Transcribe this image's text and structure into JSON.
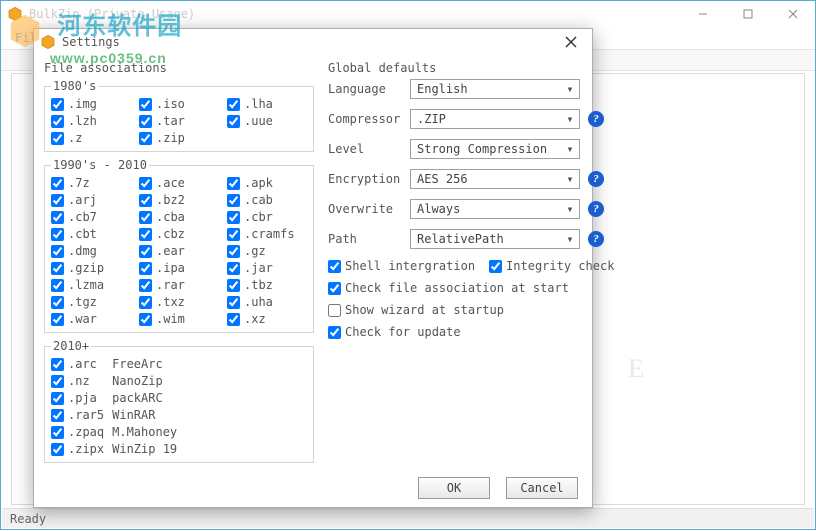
{
  "watermark": {
    "line1": "河东软件园",
    "line2": "www.pc0359.cn"
  },
  "main": {
    "title": "BulkZip (Private Usage)",
    "menu": {
      "file": "File"
    },
    "status": "Ready",
    "ghost_char": "E"
  },
  "dialog": {
    "title": "Settings",
    "left_title": "File associations",
    "g1980_legend": "1980's",
    "g1990_legend": "1990's - 2010",
    "g2010_legend": "2010+",
    "g1980": [
      {
        "ext": ".img",
        "checked": true
      },
      {
        "ext": ".iso",
        "checked": true
      },
      {
        "ext": ".lha",
        "checked": true
      },
      {
        "ext": ".lzh",
        "checked": true
      },
      {
        "ext": ".tar",
        "checked": true
      },
      {
        "ext": ".uue",
        "checked": true
      },
      {
        "ext": ".z",
        "checked": true
      },
      {
        "ext": ".zip",
        "checked": true
      }
    ],
    "g1990": [
      {
        "ext": ".7z",
        "checked": true
      },
      {
        "ext": ".ace",
        "checked": true
      },
      {
        "ext": ".apk",
        "checked": true
      },
      {
        "ext": ".arj",
        "checked": true
      },
      {
        "ext": ".bz2",
        "checked": true
      },
      {
        "ext": ".cab",
        "checked": true
      },
      {
        "ext": ".cb7",
        "checked": true
      },
      {
        "ext": ".cba",
        "checked": true
      },
      {
        "ext": ".cbr",
        "checked": true
      },
      {
        "ext": ".cbt",
        "checked": true
      },
      {
        "ext": ".cbz",
        "checked": true
      },
      {
        "ext": ".cramfs",
        "checked": true
      },
      {
        "ext": ".dmg",
        "checked": true
      },
      {
        "ext": ".ear",
        "checked": true
      },
      {
        "ext": ".gz",
        "checked": true
      },
      {
        "ext": ".gzip",
        "checked": true
      },
      {
        "ext": ".ipa",
        "checked": true
      },
      {
        "ext": ".jar",
        "checked": true
      },
      {
        "ext": ".lzma",
        "checked": true
      },
      {
        "ext": ".rar",
        "checked": true
      },
      {
        "ext": ".tbz",
        "checked": true
      },
      {
        "ext": ".tgz",
        "checked": true
      },
      {
        "ext": ".txz",
        "checked": true
      },
      {
        "ext": ".uha",
        "checked": true
      },
      {
        "ext": ".war",
        "checked": true
      },
      {
        "ext": ".wim",
        "checked": true
      },
      {
        "ext": ".xz",
        "checked": true
      }
    ],
    "g2010": [
      {
        "ext": ".arc",
        "name": "FreeArc",
        "checked": true
      },
      {
        "ext": ".nz",
        "name": "NanoZip",
        "checked": true
      },
      {
        "ext": ".pja",
        "name": "packARC",
        "checked": true
      },
      {
        "ext": ".rar5",
        "name": "WinRAR",
        "checked": true
      },
      {
        "ext": ".zpaq",
        "name": "M.Mahoney",
        "checked": true
      },
      {
        "ext": ".zipx",
        "name": "WinZip 19",
        "checked": true
      }
    ],
    "right_title": "Global defaults",
    "fields": {
      "language": {
        "label": "Language",
        "value": "English",
        "help": false
      },
      "compressor": {
        "label": "Compressor",
        "value": ".ZIP",
        "help": true
      },
      "level": {
        "label": "Level",
        "value": "Strong Compression",
        "help": false
      },
      "encryption": {
        "label": "Encryption",
        "value": "AES 256",
        "help": true
      },
      "overwrite": {
        "label": "Overwrite",
        "value": "Always",
        "help": true
      },
      "path": {
        "label": "Path",
        "value": "RelativePath",
        "help": true
      }
    },
    "checks": {
      "shell_integration": {
        "label": "Shell intergration",
        "checked": true
      },
      "integrity_check": {
        "label": "Integrity check",
        "checked": true
      },
      "check_assoc": {
        "label": "Check file association at start",
        "checked": true
      },
      "show_wizard": {
        "label": "Show wizard at startup",
        "checked": false
      },
      "check_update": {
        "label": "Check for update",
        "checked": true
      }
    },
    "buttons": {
      "ok": "OK",
      "cancel": "Cancel"
    }
  }
}
